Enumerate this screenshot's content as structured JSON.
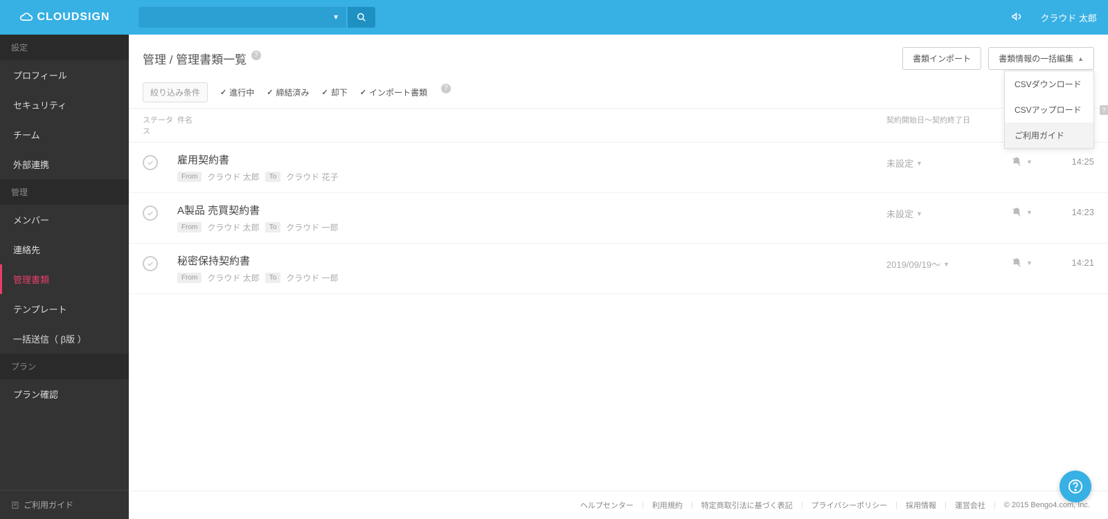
{
  "brand": "CLOUDSIGN",
  "user_name": "クラウド 太郎",
  "sidebar": {
    "section_settings": "設定",
    "items_settings": [
      "プロフィール",
      "セキュリティ",
      "チーム",
      "外部連携"
    ],
    "section_admin": "管理",
    "items_admin": [
      "メンバー",
      "連絡先",
      "管理書類",
      "テンプレート",
      "一括送信（ β版 ）"
    ],
    "section_plan": "プラン",
    "items_plan": [
      "プラン確認"
    ],
    "footer": "ご利用ガイド",
    "active": "管理書類"
  },
  "page": {
    "breadcrumb1": "管理",
    "breadcrumb_sep": " / ",
    "breadcrumb2": "管理書類一覧",
    "import_btn": "書類インポート",
    "bulk_btn": "書類情報の一括編集",
    "dropdown": [
      "CSVダウンロード",
      "CSVアップロード",
      "ご利用ガイド"
    ],
    "dropdown_hover_index": 2
  },
  "filters": {
    "label": "絞り込み条件",
    "items": [
      "進行中",
      "締結済み",
      "却下",
      "インポート書類"
    ]
  },
  "columns": {
    "status": "ステータス",
    "name": "件名",
    "date": "契約開始日〜契約終了日"
  },
  "rows": [
    {
      "title": "雇用契約書",
      "from_label": "From",
      "from": "クラウド 太郎",
      "to_label": "To",
      "to": "クラウド 花子",
      "date": "未設定",
      "time": "14:25"
    },
    {
      "title": "A製品 売買契約書",
      "from_label": "From",
      "from": "クラウド 太郎",
      "to_label": "To",
      "to": "クラウド 一郎",
      "date": "未設定",
      "time": "14:23"
    },
    {
      "title": "秘密保持契約書",
      "from_label": "From",
      "from": "クラウド 太郎",
      "to_label": "To",
      "to": "クラウド 一郎",
      "date": "2019/09/19〜",
      "time": "14:21"
    }
  ],
  "footer": {
    "links": [
      "ヘルプセンター",
      "利用規約",
      "特定商取引法に基づく表記",
      "プライバシーポリシー",
      "採用情報",
      "運営会社"
    ],
    "copyright": "© 2015 Bengo4.com, Inc."
  }
}
